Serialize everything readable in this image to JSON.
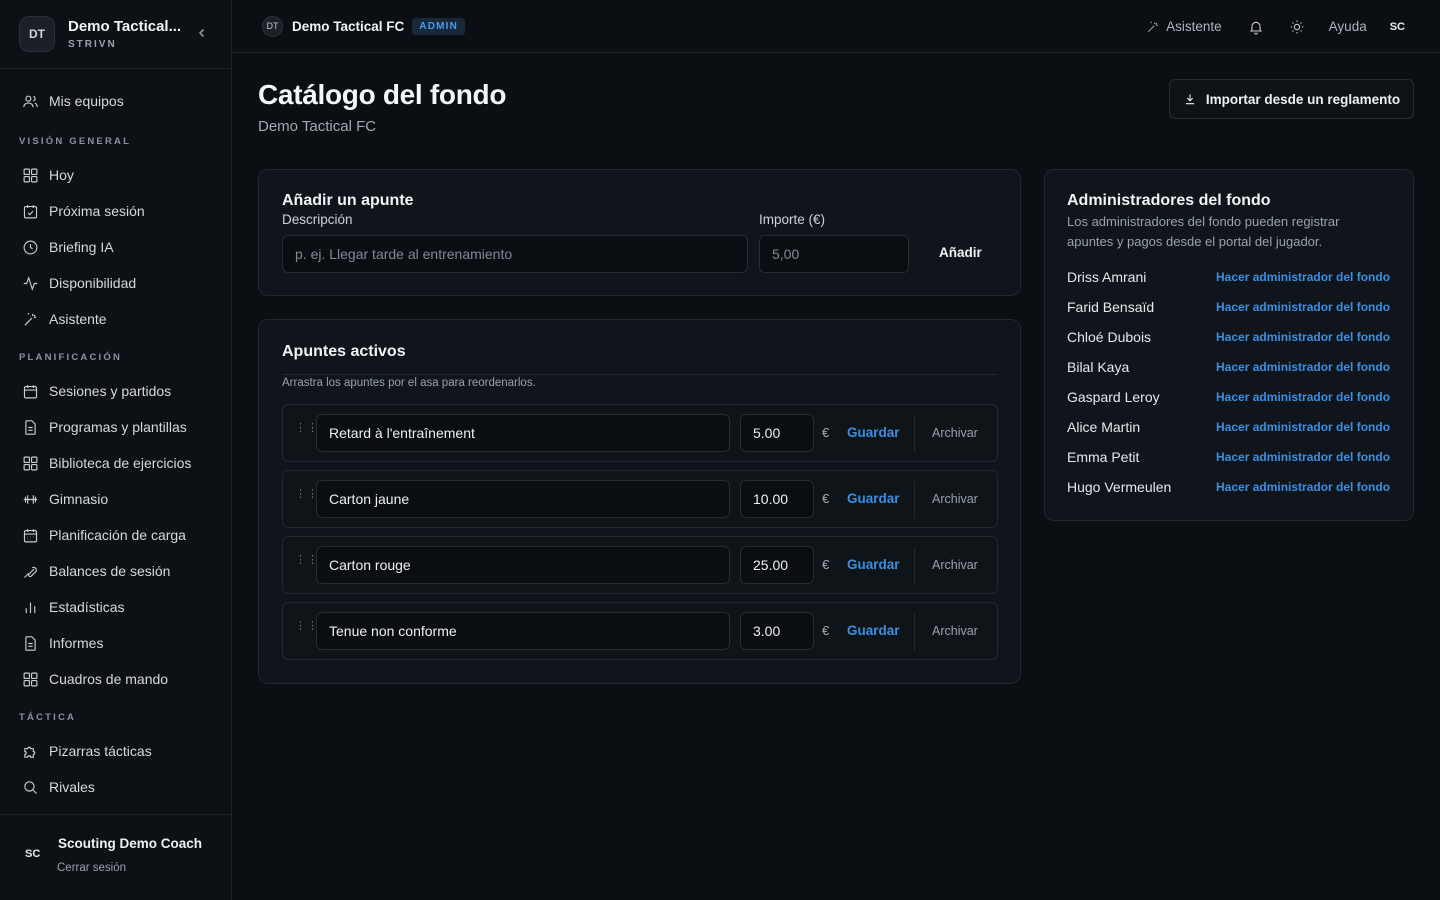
{
  "sidebar": {
    "team_avatar": "DT",
    "team_name": "Demo Tactical...",
    "team_sub": "STRIVN",
    "collapse_icon": "chevron-left-icon",
    "top_item": "Mis equipos",
    "sections": [
      {
        "title": "VISIÓN GENERAL",
        "items": [
          "Hoy",
          "Próxima sesión",
          "Briefing IA",
          "Disponibilidad",
          "Asistente"
        ]
      },
      {
        "title": "PLANIFICACIÓN",
        "items": [
          "Sesiones y partidos",
          "Programas y plantillas",
          "Biblioteca de ejercicios",
          "Gimnasio",
          "Planificación de carga",
          "Balances de sesión",
          "Estadísticas",
          "Informes",
          "Cuadros de mando"
        ]
      },
      {
        "title": "TÁCTICA",
        "items": [
          "Pizarras tácticas",
          "Rivales"
        ]
      }
    ],
    "user_avatar": "SC",
    "user_name": "Scouting Demo Coach",
    "logout": "Cerrar sesión"
  },
  "topbar": {
    "team_avatar": "DT",
    "team_name": "Demo Tactical FC",
    "badge": "ADMIN",
    "assistant": "Asistente",
    "help": "Ayuda",
    "user": "SC"
  },
  "page": {
    "title": "Catálogo del fondo",
    "subtitle": "Demo Tactical FC",
    "import_button": "Importar desde un reglamento"
  },
  "add_card": {
    "title": "Añadir un apunte",
    "desc_label": "Descripción",
    "desc_placeholder": "p. ej. Llegar tarde al entrenamiento",
    "amount_label": "Importe (€)",
    "amount_placeholder": "5,00",
    "add_button": "Añadir"
  },
  "list_card": {
    "title": "Apuntes activos",
    "hint": "Arrastra los apuntes por el asa para reordenarlos.",
    "currency": "€",
    "save_label": "Guardar",
    "archive_label": "Archivar",
    "items": [
      {
        "name": "Retard à l'entraînement",
        "amount": "5.00"
      },
      {
        "name": "Carton jaune",
        "amount": "10.00"
      },
      {
        "name": "Carton rouge",
        "amount": "25.00"
      },
      {
        "name": "Tenue non conforme",
        "amount": "3.00"
      }
    ]
  },
  "admins_card": {
    "title": "Administradores del fondo",
    "description": "Los administradores del fondo pueden registrar apuntes y pagos desde el portal del jugador.",
    "action_label": "Hacer administrador del fondo",
    "players": [
      "Driss Amrani",
      "Farid Bensaïd",
      "Chloé Dubois",
      "Bilal Kaya",
      "Gaspard Leroy",
      "Alice Martin",
      "Emma Petit",
      "Hugo Vermeulen"
    ]
  }
}
